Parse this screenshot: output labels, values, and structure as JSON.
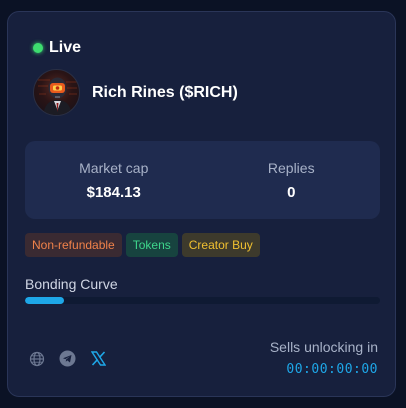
{
  "status": {
    "label": "Live",
    "color": "#3ddc6f"
  },
  "token": {
    "name": "Rich Rines ($RICH)",
    "avatar_icon": "robot-avatar-icon"
  },
  "stats": [
    {
      "label": "Market cap",
      "value": "$184.13"
    },
    {
      "label": "Replies",
      "value": "0"
    }
  ],
  "tags": [
    {
      "label": "Non-refundable",
      "color": "#f0824a"
    },
    {
      "label": "Tokens",
      "color": "#3ed68c"
    },
    {
      "label": "Creator Buy",
      "color": "#f0c030"
    }
  ],
  "bonding_curve": {
    "label": "Bonding Curve",
    "progress_fraction": 0.11,
    "color": "#1ea7e8"
  },
  "socials": [
    {
      "icon": "globe-icon"
    },
    {
      "icon": "telegram-icon"
    },
    {
      "icon": "x-twitter-icon"
    }
  ],
  "sells": {
    "label": "Sells unlocking in",
    "countdown": "00:00:00:00"
  }
}
